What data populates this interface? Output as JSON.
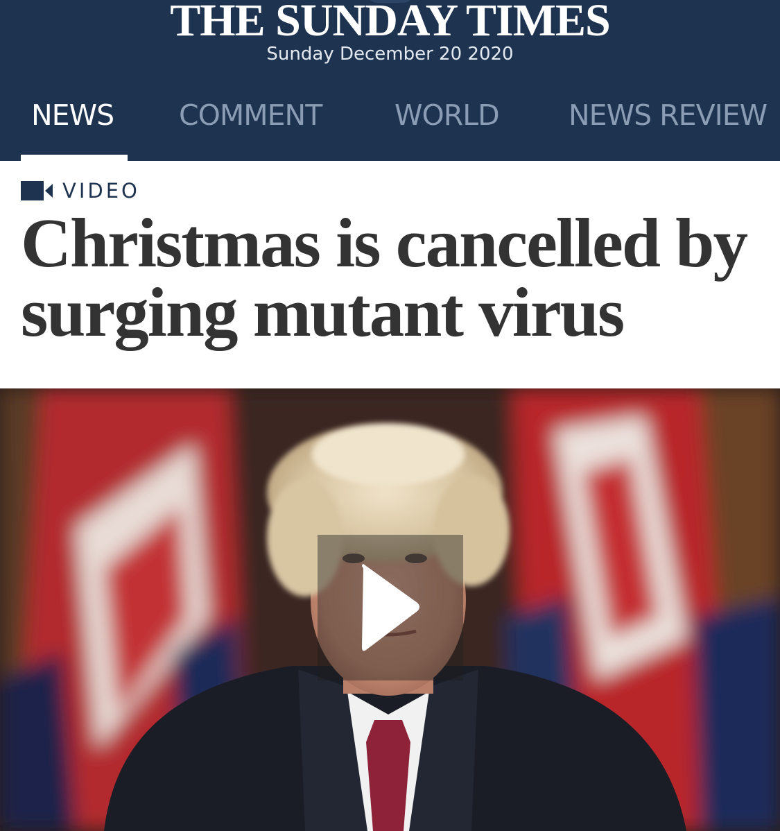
{
  "masthead": {
    "title": "THE SUNDAY TIMES",
    "date": "Sunday December 20 2020"
  },
  "nav": {
    "tabs": [
      {
        "label": "NEWS",
        "active": true
      },
      {
        "label": "COMMENT",
        "active": false
      },
      {
        "label": "WORLD",
        "active": false
      },
      {
        "label": "NEWS REVIEW",
        "active": false
      }
    ]
  },
  "article": {
    "tag": "VIDEO",
    "tag_icon": "video-camera-icon",
    "headline": "Christmas is cancelled by surging mutant virus"
  },
  "video": {
    "play_icon": "play-icon"
  },
  "colors": {
    "brand_navy": "#1d3350",
    "inactive_tab": "#8a9db5",
    "headline_text": "#333333"
  }
}
